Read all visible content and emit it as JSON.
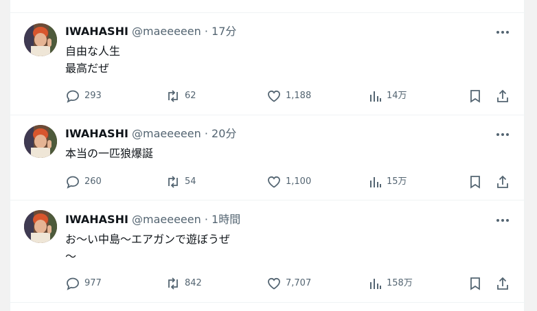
{
  "tweets": [
    {
      "name": "IWAHASHI",
      "handle": "@maeeeeen",
      "separator": "·",
      "time": "17分",
      "text": "自由な人生\n最高だぜ",
      "replies": "293",
      "retweets": "62",
      "likes": "1,188",
      "views": "14万"
    },
    {
      "name": "IWAHASHI",
      "handle": "@maeeeeen",
      "separator": "·",
      "time": "20分",
      "text": "本当の一匹狼爆誕",
      "replies": "260",
      "retweets": "54",
      "likes": "1,100",
      "views": "15万"
    },
    {
      "name": "IWAHASHI",
      "handle": "@maeeeeen",
      "separator": "·",
      "time": "1時間",
      "text": "お〜い中島〜エアガンで遊ぼうぜ\n〜",
      "replies": "977",
      "retweets": "842",
      "likes": "7,707",
      "views": "158万"
    }
  ],
  "icons": {
    "more": "more-dots-icon",
    "reply": "reply-bubble-icon",
    "retweet": "retweet-arrows-icon",
    "like": "heart-icon",
    "views": "bar-chart-icon",
    "bookmark": "bookmark-icon",
    "share": "share-upload-icon"
  },
  "colors": {
    "text": "#0f1419",
    "secondary": "#536471",
    "divider": "#eff3f4"
  }
}
